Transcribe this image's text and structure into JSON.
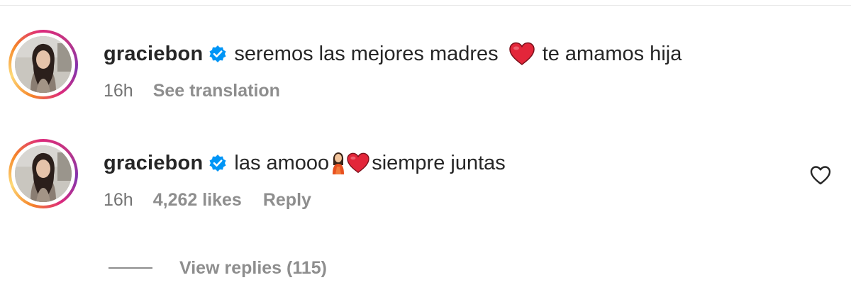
{
  "comments": [
    {
      "username": "graciebon",
      "text_before_emoji": "seremos las mejores madres",
      "text_after_emoji": "te amamos hija",
      "time": "16h",
      "action": "See translation"
    },
    {
      "username": "graciebon",
      "text_before_emoji": "las amooo",
      "text_after_emoji": "siempre juntas",
      "time": "16h",
      "likes": "4,262 likes",
      "action": "Reply"
    }
  ],
  "view_replies": {
    "label": "View replies (115)"
  },
  "icons": {
    "verified": "verified-badge-icon",
    "like": "heart-outline-icon",
    "emoji_heart": "red-heart-emoji",
    "emoji_woman": "woman-emoji"
  },
  "colors": {
    "verified_blue": "#0095f6",
    "heart_red": "#e3263a",
    "meta_gray": "#8e8e8e"
  }
}
